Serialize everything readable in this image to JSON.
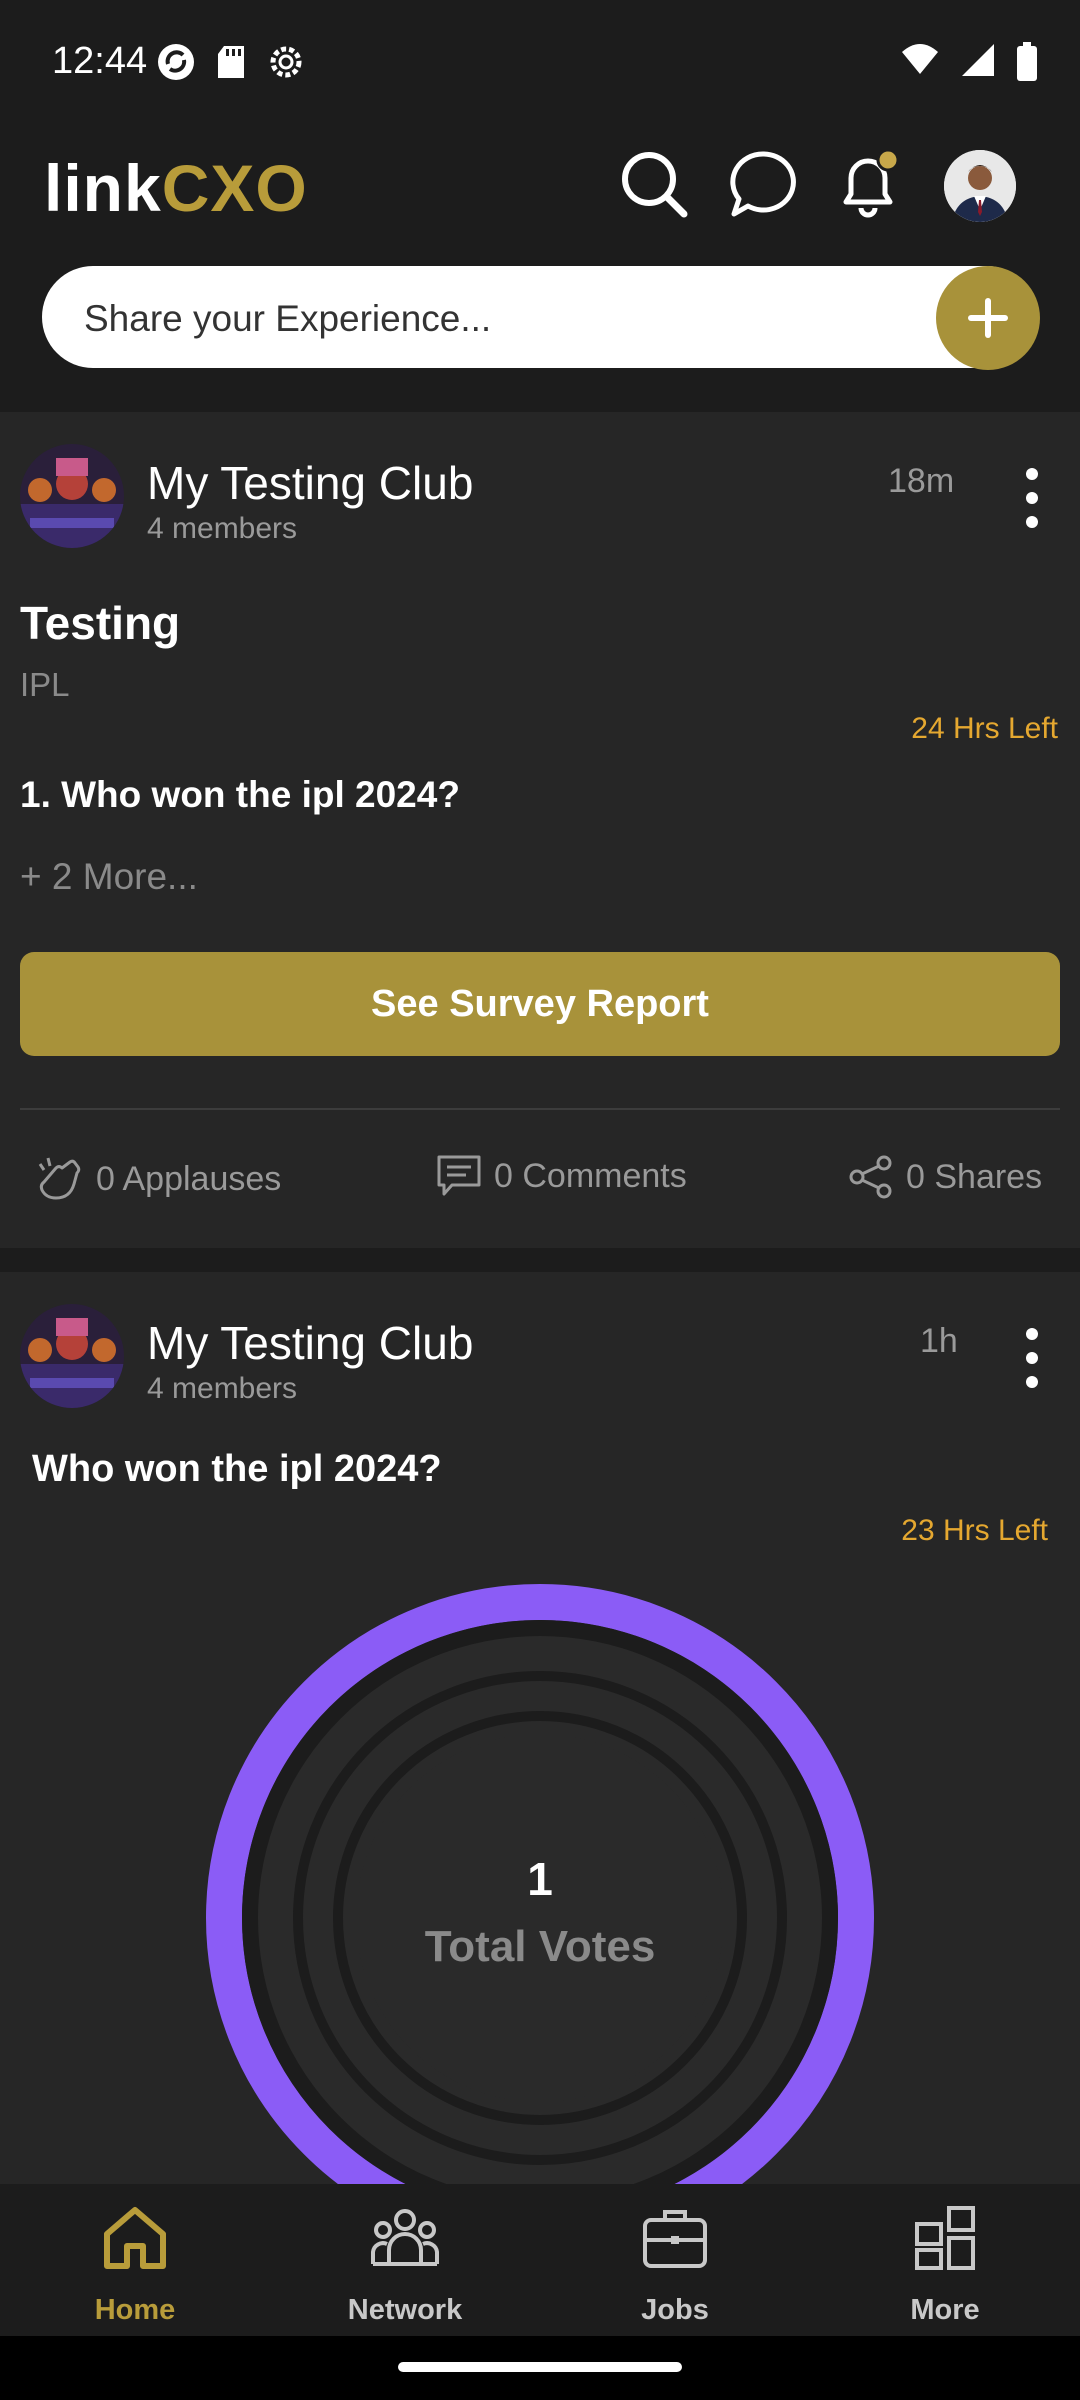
{
  "status_bar": {
    "time": "12:44",
    "left_icons": [
      "sync-icon",
      "sd-card-icon",
      "settings-icon"
    ],
    "right_icons": [
      "wifi-icon",
      "signal-icon",
      "battery-icon"
    ]
  },
  "header": {
    "logo_part1": "link",
    "logo_part2": "CXO",
    "icons": [
      "search-icon",
      "chat-icon",
      "bell-icon",
      "profile-avatar"
    ],
    "share_placeholder": "Share your Experience..."
  },
  "posts": [
    {
      "club_name": "My Testing Club",
      "members": "4 members",
      "time": "18m",
      "title": "Testing",
      "subtitle": "IPL",
      "time_left": "24 Hrs Left",
      "question": "1. Who won the ipl 2024?",
      "more": "+ 2 More...",
      "button": "See Survey Report",
      "applauses": "0 Applauses",
      "comments": "0 Comments",
      "shares": "0 Shares"
    },
    {
      "club_name": "My Testing Club",
      "members": "4 members",
      "time": "1h",
      "question": "Who won the ipl 2024?",
      "time_left": "23 Hrs Left",
      "total_votes_number": "1",
      "total_votes_label": "Total Votes"
    }
  ],
  "chart_data": {
    "type": "pie",
    "categories": [
      "Votes"
    ],
    "values": [
      1
    ],
    "center_value": "1",
    "center_label": "Total Votes",
    "ring_color": "#8b5cf6"
  },
  "bottom_nav": [
    {
      "label": "Home",
      "icon": "home-icon",
      "active": true
    },
    {
      "label": "Network",
      "icon": "network-icon",
      "active": false
    },
    {
      "label": "Jobs",
      "icon": "briefcase-icon",
      "active": false
    },
    {
      "label": "More",
      "icon": "grid-icon",
      "active": false
    }
  ],
  "colors": {
    "accent": "#a8923a",
    "gold_text": "#b89c3a",
    "warning": "#e5a830",
    "chart_ring": "#8b5cf6",
    "background": "#1c1c1c",
    "card": "#262626"
  }
}
